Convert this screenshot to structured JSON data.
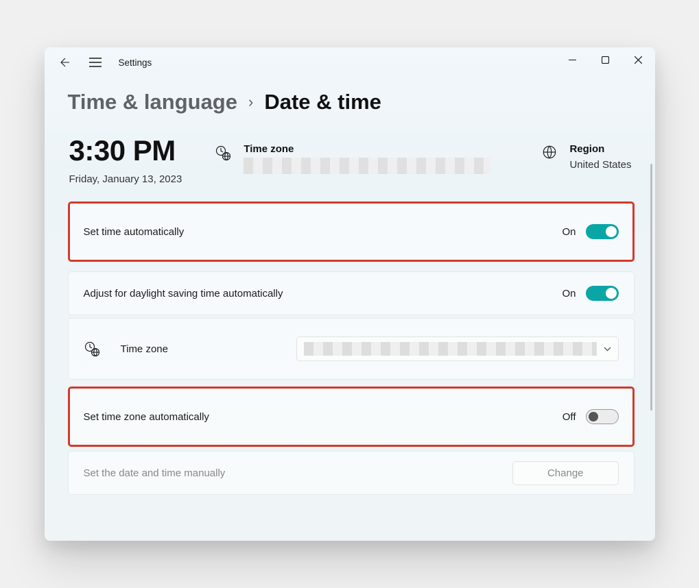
{
  "app_title": "Settings",
  "breadcrumb": {
    "parent": "Time & language",
    "current": "Date & time"
  },
  "clock": {
    "time": "3:30 PM",
    "date": "Friday, January 13, 2023"
  },
  "header_info": {
    "timezone_label": "Time zone",
    "region_label": "Region",
    "region_value": "United States"
  },
  "settings": {
    "set_time_auto": {
      "label": "Set time automatically",
      "state": "On"
    },
    "dst_auto": {
      "label": "Adjust for daylight saving time automatically",
      "state": "On"
    },
    "timezone_row_label": "Time zone",
    "set_tz_auto": {
      "label": "Set time zone automatically",
      "state": "Off"
    },
    "manual": {
      "label": "Set the date and time manually",
      "button": "Change"
    }
  }
}
